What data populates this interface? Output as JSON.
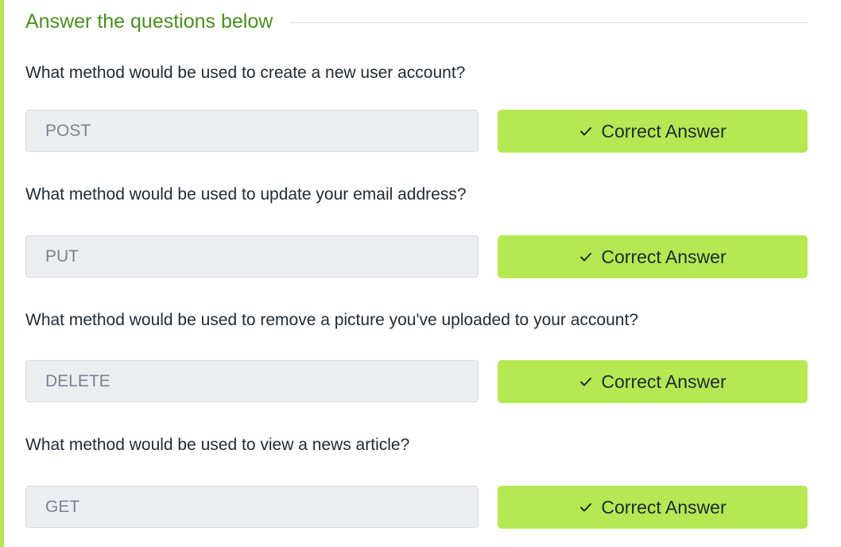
{
  "section": {
    "title": "Answer the questions below"
  },
  "questions": [
    {
      "text": "What method would be used to create a new user account?",
      "answer": "POST",
      "button_label": "Correct Answer",
      "button_icon": "check-icon"
    },
    {
      "text": "What method would be used to update your email address?",
      "answer": "PUT",
      "button_label": "Correct Answer",
      "button_icon": "check-icon"
    },
    {
      "text": "What method would be used to remove a picture you've uploaded to your account?",
      "answer": "DELETE",
      "button_label": "Correct Answer",
      "button_icon": "check-icon"
    },
    {
      "text": "What method would be used to view a news article?",
      "answer": "GET",
      "button_label": "Correct Answer",
      "button_icon": "check-icon"
    }
  ],
  "colors": {
    "accent_green": "#b5e853",
    "title_green": "#4a8f1f",
    "input_background": "#eceef2"
  }
}
